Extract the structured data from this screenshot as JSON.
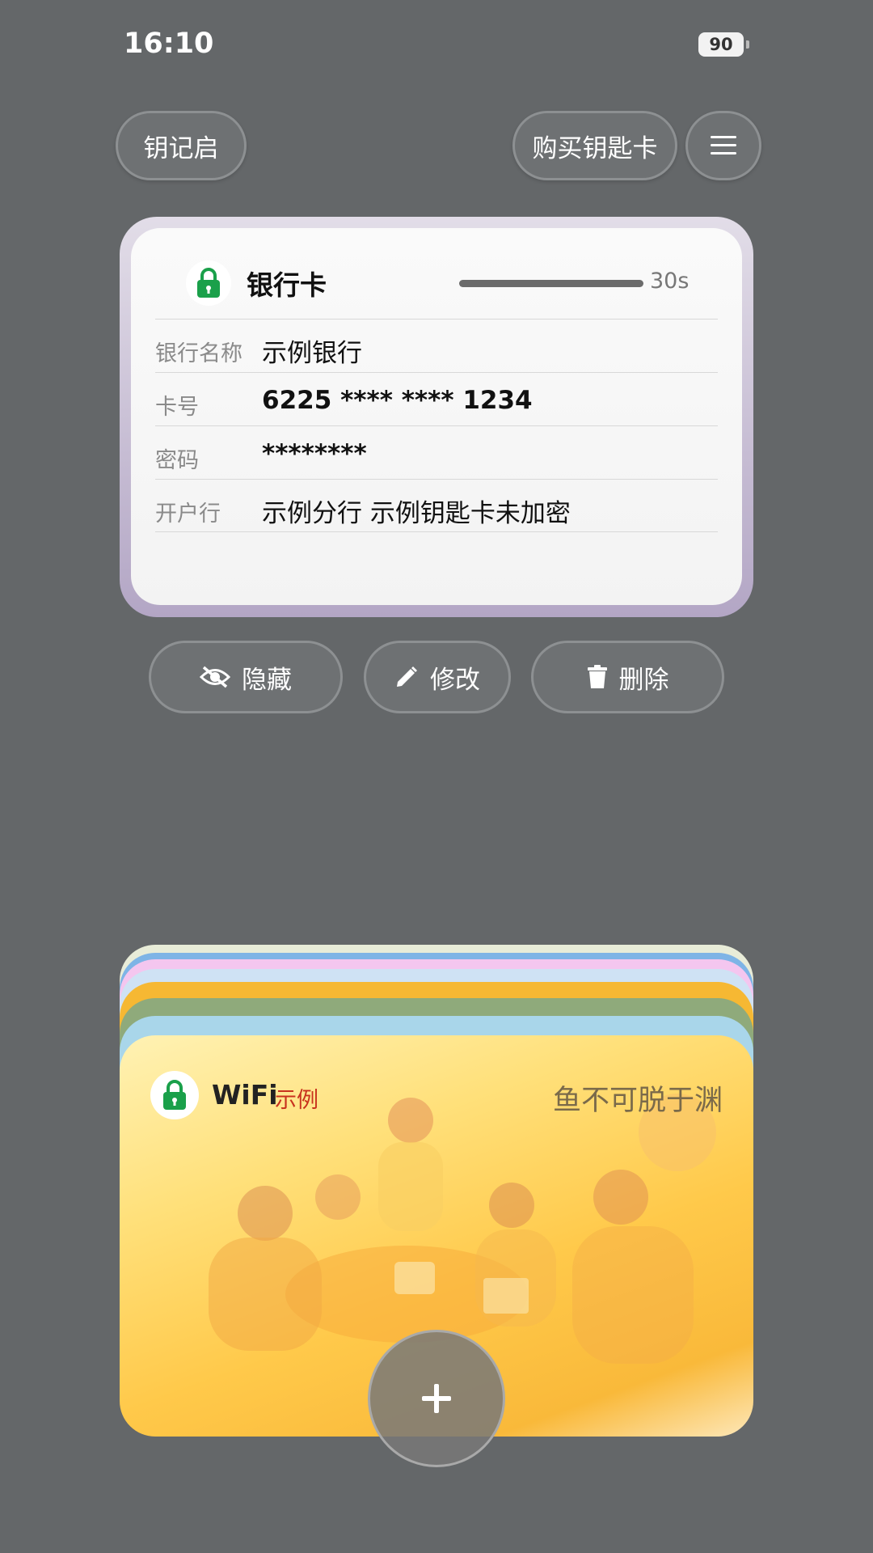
{
  "status": {
    "time": "16:10",
    "battery": "90"
  },
  "header": {
    "app_title": "钥记启",
    "buy_label": "购买钥匙卡",
    "menu_icon": "hamburger-menu-icon"
  },
  "card": {
    "title": "银行卡",
    "countdown": "30s",
    "countdown_fraction": 1.0,
    "fields": [
      {
        "label": "银行名称",
        "value": "示例银行"
      },
      {
        "label": "卡号",
        "value": "6225 **** **** 1234"
      },
      {
        "label": "密码",
        "value": "********"
      },
      {
        "label": "开户行",
        "value": "示例分行  示例钥匙卡未加密"
      }
    ]
  },
  "actions": {
    "hide": "隐藏",
    "edit": "修改",
    "delete": "删除"
  },
  "stack": {
    "wifi_title": "WiFi",
    "wifi_tag": "示例",
    "wifi_motto": "鱼不可脱于渊"
  },
  "colors": {
    "background": "#646769",
    "lock_green": "#1aa04a",
    "tag_red": "#c8321e"
  }
}
